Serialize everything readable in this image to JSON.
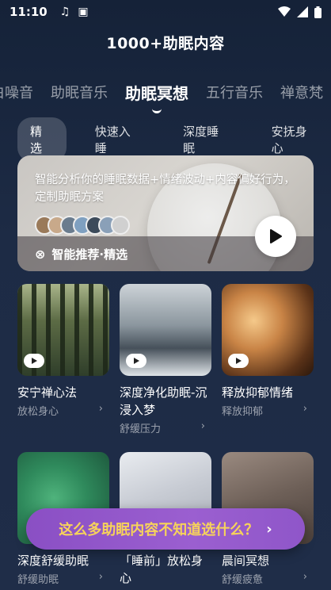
{
  "status_bar": {
    "time": "11:10",
    "icons": [
      "music-note-icon",
      "a-box-icon"
    ],
    "right_icons": [
      "wifi-icon",
      "signal-icon",
      "battery-icon"
    ]
  },
  "header": {
    "title": "1000+助眠内容"
  },
  "category_tabs": [
    {
      "label": "白噪音",
      "active": false
    },
    {
      "label": "助眠音乐",
      "active": false
    },
    {
      "label": "助眠冥想",
      "active": true
    },
    {
      "label": "五行音乐",
      "active": false
    },
    {
      "label": "禅意梵",
      "active": false
    }
  ],
  "sub_tabs": [
    {
      "label": "精选",
      "active": true
    },
    {
      "label": "快速入睡",
      "active": false
    },
    {
      "label": "深度睡眠",
      "active": false
    },
    {
      "label": "安抚身心",
      "active": false
    }
  ],
  "banner": {
    "description": "智能分析你的睡眠数据+情绪波动+内容偏好行为，定制助眠方案",
    "footer_label": "智能推荐·精选",
    "avatar_colors": [
      "#9a7a5a",
      "#c8a98a",
      "#6a7c8e",
      "#7fa0c0",
      "#3c4a5a",
      "#8aa0b8",
      "#d0d0d0"
    ]
  },
  "cards": [
    {
      "title": "安宁禅心法",
      "subtitle": "放松身心",
      "thumb": "forest",
      "has_play": true
    },
    {
      "title": "深度净化助眠-沉浸入梦",
      "subtitle": "舒缓压力",
      "thumb": "mountain",
      "has_play": true
    },
    {
      "title": "释放抑郁情绪",
      "subtitle": "释放抑郁",
      "thumb": "candle",
      "has_play": true
    },
    {
      "title": "深度舒缓助眠",
      "subtitle": "舒缓助眠",
      "thumb": "leaf",
      "has_play": false
    },
    {
      "title": "「睡前」放松身心",
      "subtitle": "",
      "thumb": "hand",
      "has_play": false
    },
    {
      "title": "晨间冥想",
      "subtitle": "舒缓疲惫",
      "thumb": "tea",
      "has_play": false
    }
  ],
  "cta": {
    "label": "这么多助眠内容不知道选什么？",
    "arrow": "›"
  }
}
